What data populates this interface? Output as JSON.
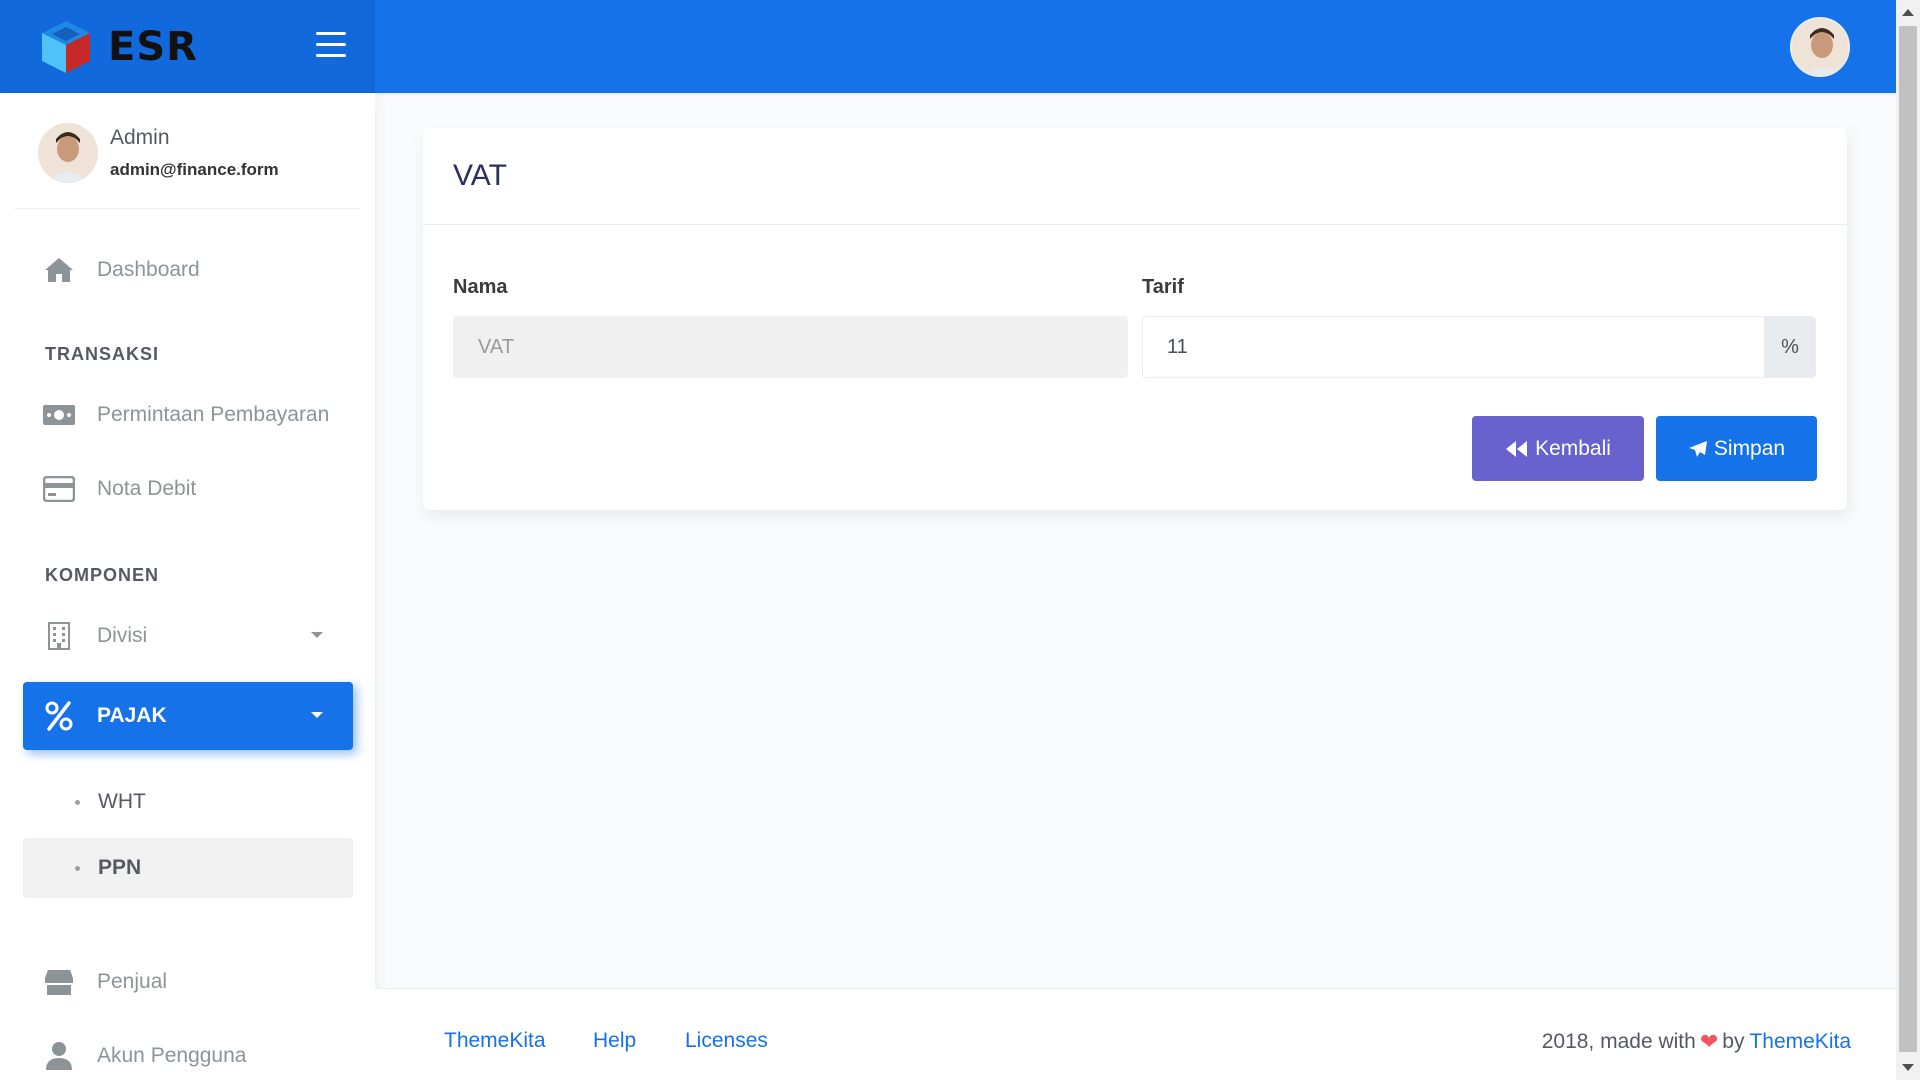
{
  "brand": {
    "name": "ESR"
  },
  "user": {
    "name": "Admin",
    "email": "admin@finance.form"
  },
  "sidebar": {
    "dashboard": "Dashboard",
    "section_transaksi": "TRANSAKSI",
    "permintaan": "Permintaan Pembayaran",
    "nota_debit": "Nota Debit",
    "section_komponen": "KOMPONEN",
    "divisi": "Divisi",
    "pajak": "PAJAK",
    "pajak_sub": [
      "WHT",
      "PPN"
    ],
    "penjual": "Penjual",
    "akun": "Akun Pengguna"
  },
  "card": {
    "title": "VAT",
    "nama_label": "Nama",
    "nama_value": "VAT",
    "tarif_label": "Tarif",
    "tarif_value": "11",
    "tarif_unit": "%",
    "back_label": "Kembali",
    "save_label": "Simpan"
  },
  "footer": {
    "links": [
      "ThemeKita",
      "Help",
      "Licenses"
    ],
    "copyright_prefix": "2018, made with",
    "copyright_by": "by",
    "copyright_brand": "ThemeKita"
  },
  "colors": {
    "primary": "#1572e8",
    "secondary": "#6861ce",
    "header_logo_bg": "#1269db",
    "heart": "#f3545d"
  },
  "icons": {
    "toggle": "hamburger-icon",
    "dashboard": "home-icon",
    "permintaan": "money-icon",
    "nota_debit": "credit-card-icon",
    "divisi": "building-icon",
    "pajak": "percent-icon",
    "penjual": "store-icon",
    "akun": "user-icon",
    "back": "backward-icon",
    "save": "paper-plane-icon"
  }
}
